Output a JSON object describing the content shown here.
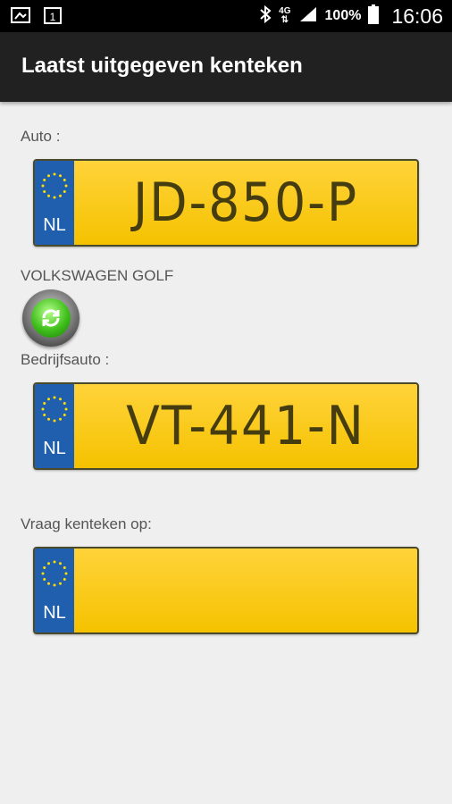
{
  "status_bar": {
    "icons_left": [
      "screenshot-icon",
      "calendar-icon"
    ],
    "calendar_day": "1",
    "network": "4G",
    "battery": "100%",
    "time": "16:06"
  },
  "app_bar": {
    "title": "Laatst uitgegeven kenteken"
  },
  "sections": {
    "auto_label": "Auto :",
    "auto_plate": {
      "country": "NL",
      "number": "JD-850-P"
    },
    "car_model": "VOLKSWAGEN GOLF",
    "company_label": "Bedrijfsauto :",
    "company_plate": {
      "country": "NL",
      "number": "VT-441-N"
    },
    "query_label": "Vraag kenteken op:",
    "query_plate": {
      "country": "NL",
      "number": ""
    }
  }
}
